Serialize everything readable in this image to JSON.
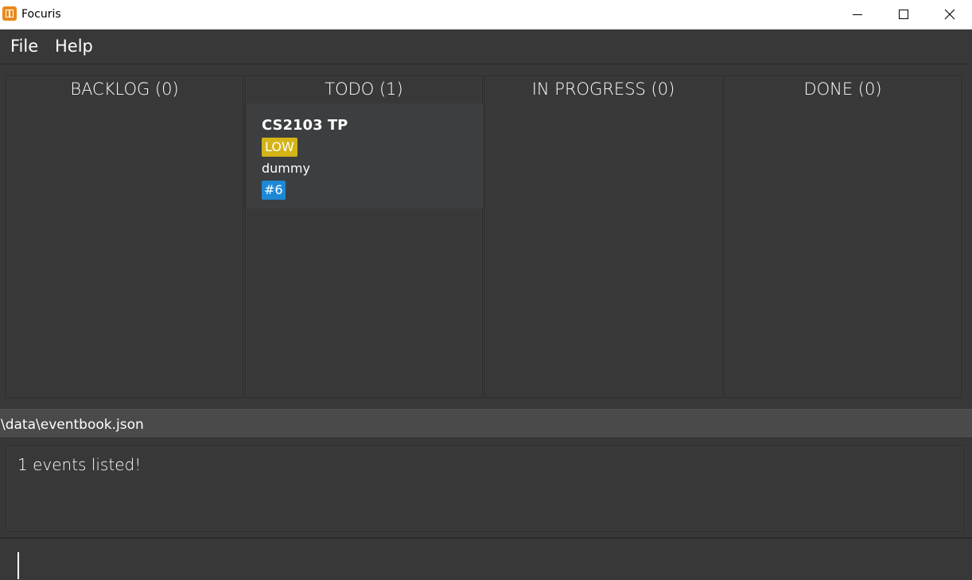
{
  "window": {
    "title": "Focuris",
    "app_icon": "focuris-app-icon",
    "controls": [
      "minimize-icon",
      "maximize-icon",
      "close-icon"
    ]
  },
  "menu": {
    "items": [
      {
        "label": "File"
      },
      {
        "label": "Help"
      }
    ]
  },
  "board": {
    "columns": [
      {
        "header": "BACKLOG (0)",
        "cards": []
      },
      {
        "header": "TODO (1)",
        "cards": [
          {
            "title": "CS2103 TP",
            "priority": "LOW",
            "description": "dummy",
            "id": "#6"
          }
        ]
      },
      {
        "header": "IN PROGRESS (0)",
        "cards": []
      },
      {
        "header": "DONE (0)",
        "cards": []
      }
    ]
  },
  "status": {
    "file_path": "\\data\\eventbook.json"
  },
  "result": {
    "message": "1 events listed!"
  },
  "command": {
    "value": "",
    "placeholder": ""
  },
  "colors": {
    "background": "#383838",
    "card": "#3c3e3f",
    "priority_low": "#d4b417",
    "id_tag": "#1d89d6",
    "app_icon": "#e8891c"
  }
}
